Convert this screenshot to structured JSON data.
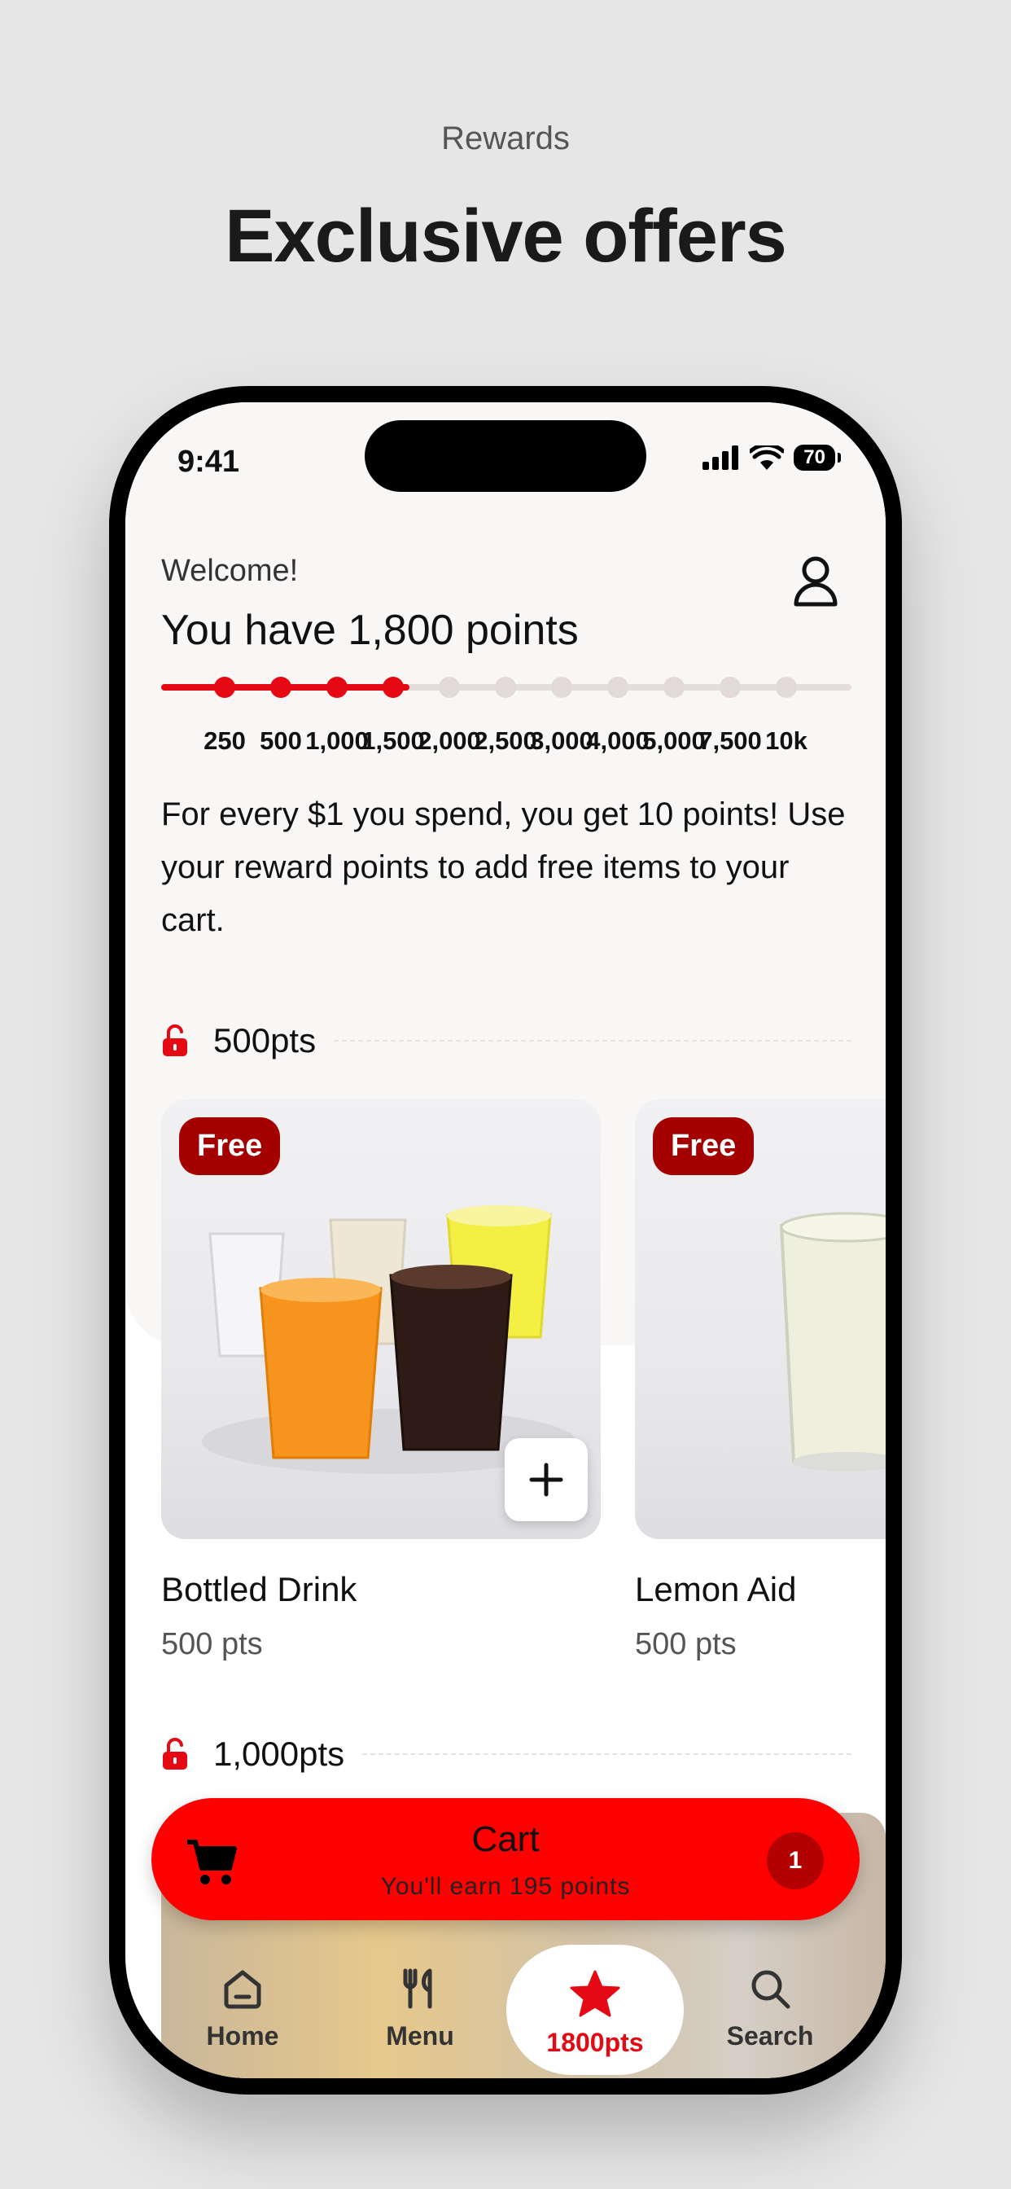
{
  "header": {
    "subtitle": "Rewards",
    "title": "Exclusive offers"
  },
  "status": {
    "time": "9:41",
    "battery": "70"
  },
  "rewards": {
    "welcome": "Welcome!",
    "points_title": "You have 1,800 points",
    "progress_fraction": 0.36,
    "ticks": [
      "250",
      "500",
      "1,000",
      "1,500",
      "2,000",
      "2,500",
      "3,000",
      "4,000",
      "5,000",
      "7,500",
      "10k"
    ],
    "reached_count": 4,
    "info": "For every $1 you spend, you get 10 points! Use your reward points to add free items to your cart."
  },
  "sections": [
    {
      "label": "500pts"
    },
    {
      "label": "1,000pts"
    }
  ],
  "items": [
    {
      "badge": "Free",
      "name": "Bottled Drink",
      "pts": "500 pts"
    },
    {
      "badge": "Free",
      "name": "Lemon Aid",
      "pts": "500 pts"
    }
  ],
  "cart": {
    "title": "Cart",
    "subtitle": "You'll earn 195 points",
    "count": "1"
  },
  "tabs": [
    {
      "label": "Home",
      "icon": "home-icon"
    },
    {
      "label": "Menu",
      "icon": "utensils-icon"
    },
    {
      "label": "1800pts",
      "icon": "star-icon"
    },
    {
      "label": "Search",
      "icon": "search-icon"
    }
  ],
  "colors": {
    "accent": "#e50914",
    "cart": "#ff0000",
    "badge": "#a40000"
  }
}
